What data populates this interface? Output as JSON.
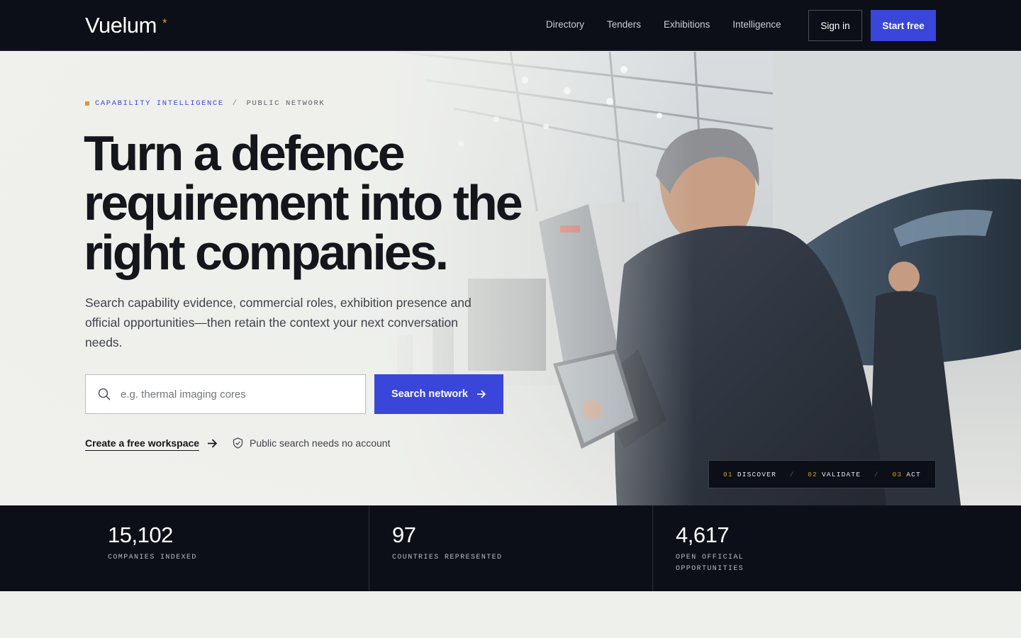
{
  "nav": {
    "logo": "Vuelum",
    "logo_mark": "*",
    "links": [
      "Directory",
      "Tenders",
      "Exhibitions",
      "Intelligence"
    ],
    "sign_in": "Sign in",
    "start_free": "Start free"
  },
  "hero": {
    "eyebrow_primary": "CAPABILITY INTELLIGENCE",
    "eyebrow_separator": "/",
    "eyebrow_secondary": "PUBLIC NETWORK",
    "headline_line1": "Turn a defence",
    "headline_line2": "requirement into the",
    "headline_line3": "right companies.",
    "subcopy": "Search capability evidence, commercial roles, exhibition presence and official opportunities—then retain the context your next conversation needs.",
    "search_placeholder": "e.g. thermal imaging cores",
    "search_button": "Search network",
    "create_link": "Create a free workspace",
    "public_note": "Public search needs no account",
    "steps": [
      {
        "num": "01",
        "label": "DISCOVER"
      },
      {
        "num": "02",
        "label": "VALIDATE"
      },
      {
        "num": "03",
        "label": "ACT"
      }
    ],
    "steps_separator": "/"
  },
  "stats": [
    {
      "value": "15,102",
      "label": "COMPANIES INDEXED"
    },
    {
      "value": "97",
      "label": "COUNTRIES REPRESENTED"
    },
    {
      "value": "4,617",
      "label": "OPEN OFFICIAL OPPORTUNITIES"
    }
  ],
  "colors": {
    "accent": "#3a46d9",
    "highlight": "#d99a2b",
    "dark": "#0c0f17"
  },
  "icons": [
    "search-icon",
    "arrow-right-icon",
    "shield-check-icon"
  ]
}
